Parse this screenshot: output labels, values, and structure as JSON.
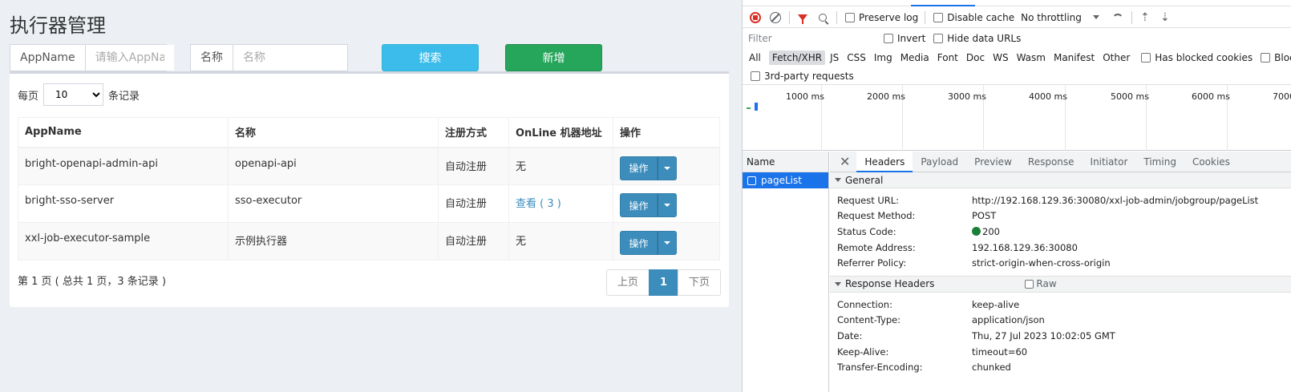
{
  "app": {
    "title": "执行器管理",
    "search": {
      "appname_label": "AppName",
      "appname_placeholder": "请输入AppName",
      "name_label": "名称",
      "name_placeholder": "名称",
      "search_button": "搜索",
      "add_button": "新增"
    },
    "length": {
      "prefix": "每页",
      "value": "10",
      "suffix": "条记录"
    },
    "table": {
      "headers": [
        "AppName",
        "名称",
        "注册方式",
        "OnLine 机器地址",
        "操作"
      ],
      "rows": [
        {
          "appname": "bright-openapi-admin-api",
          "name": "openapi-api",
          "reg": "自动注册",
          "online": "无",
          "op": "操作"
        },
        {
          "appname": "bright-sso-server",
          "name": "sso-executor",
          "reg": "自动注册",
          "online": "查看 ( 3 )",
          "op": "操作"
        },
        {
          "appname": "xxl-job-executor-sample",
          "name": "示例执行器",
          "reg": "自动注册",
          "online": "无",
          "op": "操作"
        }
      ]
    },
    "info": "第 1 页 ( 总共 1 页，3 条记录 )",
    "pager": {
      "prev": "上页",
      "current": "1",
      "next": "下页"
    },
    "colors": {
      "info": "#3cbcea",
      "success": "#26a65b",
      "primary": "#3c8dbc"
    }
  },
  "devtools": {
    "toolbar": {
      "preserve_log": "Preserve log",
      "disable_cache": "Disable cache",
      "throttling": "No throttling"
    },
    "filter": {
      "placeholder": "Filter",
      "invert": "Invert",
      "hide_data_urls": "Hide data URLs"
    },
    "types": [
      "All",
      "Fetch/XHR",
      "JS",
      "CSS",
      "Img",
      "Media",
      "Font",
      "Doc",
      "WS",
      "Wasm",
      "Manifest",
      "Other"
    ],
    "has_blocked_cookies": "Has blocked cookies",
    "blocked_requests": "Blocked Requ",
    "third_party": "3rd-party requests",
    "timeline_ticks": [
      "1000 ms",
      "2000 ms",
      "3000 ms",
      "4000 ms",
      "5000 ms",
      "6000 ms",
      "7000"
    ],
    "names_header": "Name",
    "request_name": "pageList",
    "tabs": [
      "Headers",
      "Payload",
      "Preview",
      "Response",
      "Initiator",
      "Timing",
      "Cookies"
    ],
    "general_title": "General",
    "general": [
      {
        "k": "Request URL:",
        "v": "http://192.168.129.36:30080/xxl-job-admin/jobgroup/pageList"
      },
      {
        "k": "Request Method:",
        "v": "POST"
      },
      {
        "k": "Status Code:",
        "v": "200"
      },
      {
        "k": "Remote Address:",
        "v": "192.168.129.36:30080"
      },
      {
        "k": "Referrer Policy:",
        "v": "strict-origin-when-cross-origin"
      }
    ],
    "response_title": "Response Headers",
    "raw_label": "Raw",
    "response": [
      {
        "k": "Connection:",
        "v": "keep-alive"
      },
      {
        "k": "Content-Type:",
        "v": "application/json"
      },
      {
        "k": "Date:",
        "v": "Thu, 27 Jul 2023 10:02:05 GMT"
      },
      {
        "k": "Keep-Alive:",
        "v": "timeout=60"
      },
      {
        "k": "Transfer-Encoding:",
        "v": "chunked"
      }
    ]
  }
}
